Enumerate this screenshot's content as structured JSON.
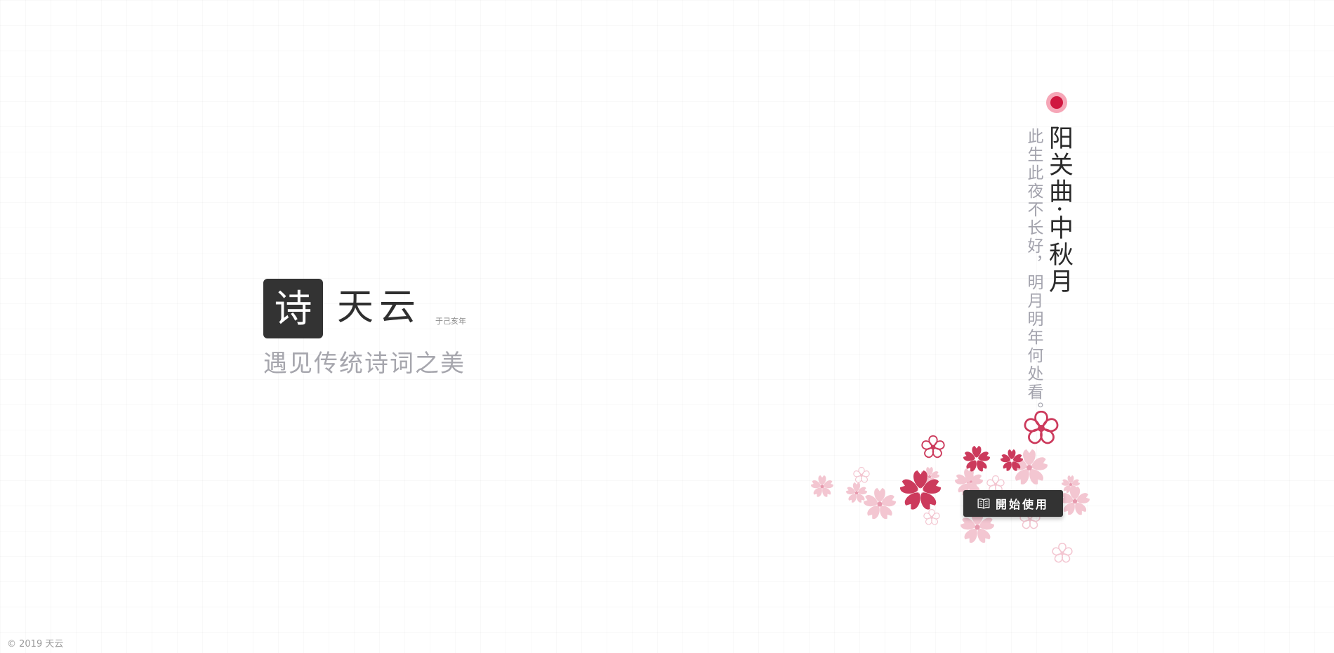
{
  "brand": {
    "logo_char": "诗",
    "name": "天云",
    "since": "于己亥年",
    "slogan": "遇见传统诗词之美"
  },
  "poem": {
    "title": "阳关曲·中秋月",
    "line": "此生此夜不长好，明月明年何处看。"
  },
  "start_button": {
    "label": "開始使用",
    "icon": "book-icon"
  },
  "footer": {
    "copyright": "© 2019 天云"
  },
  "colors": {
    "accent_red": "#d0163f",
    "dot_ring": "#f6a6b7",
    "blossom_dark": "#cc3a5c",
    "blossom_light": "#f3c6d1",
    "button_bg": "#333333",
    "slogan": "#a6a6ad"
  }
}
